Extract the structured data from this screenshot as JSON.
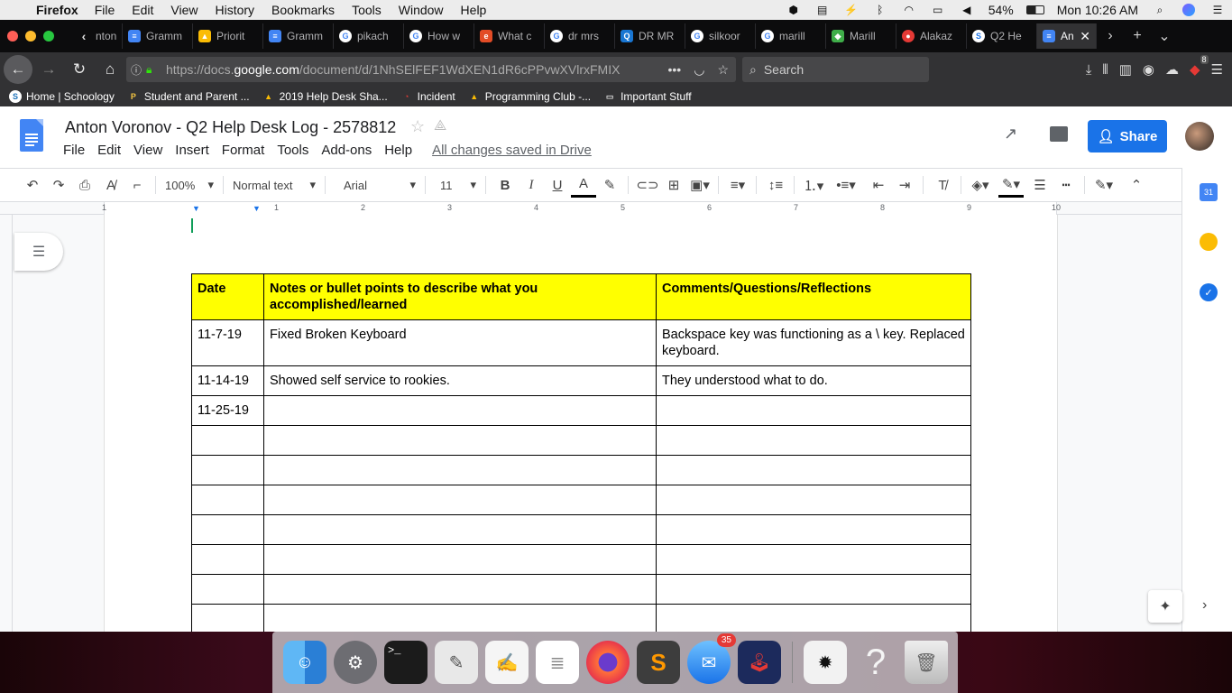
{
  "macos_menu": {
    "app_name": "Firefox",
    "items": [
      "File",
      "Edit",
      "View",
      "History",
      "Bookmarks",
      "Tools",
      "Window",
      "Help"
    ],
    "battery": "54%",
    "clock": "Mon 10:26 AM"
  },
  "browser": {
    "tabs": [
      {
        "label": "nton",
        "icon": "chevron-left"
      },
      {
        "label": "Gramm",
        "icon": "google-docs",
        "color": "#4285f4"
      },
      {
        "label": "Priorit",
        "icon": "google-drive",
        "color": "#fbbc04"
      },
      {
        "label": "Gramm",
        "icon": "google-docs",
        "color": "#4285f4"
      },
      {
        "label": "pikach",
        "icon": "google",
        "color": "#ffffff"
      },
      {
        "label": "How w",
        "icon": "google",
        "color": "#ffffff"
      },
      {
        "label": "What c",
        "icon": "e-site",
        "color": "#e34c26"
      },
      {
        "label": "dr mrs",
        "icon": "google",
        "color": "#ffffff"
      },
      {
        "label": "DR MR",
        "icon": "q-site",
        "color": "#1976d2"
      },
      {
        "label": "silkoor",
        "icon": "google",
        "color": "#ffffff"
      },
      {
        "label": "marill",
        "icon": "google",
        "color": "#ffffff"
      },
      {
        "label": "Marill",
        "icon": "pokemon",
        "color": "#3fae49"
      },
      {
        "label": "Alakaz",
        "icon": "pokeball",
        "color": "#e53935"
      },
      {
        "label": "Q2 He",
        "icon": "s-site",
        "color": "#ffffff"
      },
      {
        "label": "An",
        "icon": "google-docs",
        "color": "#4285f4",
        "active": true
      }
    ],
    "url_prefix": "https://docs.",
    "url_domain": "google.com",
    "url_path": "/document/d/1NhSElFEF1WdXEN1dR6cPPvwXVlrxFMIX",
    "search_placeholder": "Search",
    "notification_count": "8"
  },
  "bookmarks": [
    {
      "label": "Home | Schoology",
      "icon": "schoology"
    },
    {
      "label": "Student and Parent ...",
      "icon": "p-logo"
    },
    {
      "label": "2019 Help Desk Sha...",
      "icon": "google-drive"
    },
    {
      "label": "Incident",
      "icon": "servicenow"
    },
    {
      "label": "Programming Club -...",
      "icon": "google-drive"
    },
    {
      "label": "Important Stuff",
      "icon": "folder"
    }
  ],
  "doc": {
    "title": "Anton Voronov - Q2 Help Desk Log - 2578812",
    "menu": [
      "File",
      "Edit",
      "View",
      "Insert",
      "Format",
      "Tools",
      "Add-ons",
      "Help"
    ],
    "save_status": "All changes saved in Drive",
    "share_label": "Share"
  },
  "toolbar": {
    "zoom": "100%",
    "style": "Normal text",
    "font": "Arial",
    "size": "11"
  },
  "ruler": {
    "numbers": [
      "1",
      "1",
      "2",
      "3",
      "4",
      "5",
      "6",
      "7",
      "8",
      "9",
      "10"
    ]
  },
  "table": {
    "headers": [
      "Date",
      "Notes or bullet points to describe what you accomplished/learned",
      "Comments/Questions/Reflections"
    ],
    "rows": [
      [
        "11-7-19",
        "Fixed Broken Keyboard",
        "Backspace key was functioning as a \\ key. Replaced keyboard."
      ],
      [
        "11-14-19",
        "Showed self service to rookies.",
        "They understood what to do."
      ],
      [
        "11-25-19",
        "",
        ""
      ],
      [
        "",
        "",
        ""
      ],
      [
        "",
        "",
        ""
      ],
      [
        "",
        "",
        ""
      ],
      [
        "",
        "",
        ""
      ],
      [
        "",
        "",
        ""
      ],
      [
        "",
        "",
        ""
      ],
      [
        "",
        "",
        ""
      ]
    ]
  },
  "dock": {
    "mail_badge": "35",
    "apps": [
      "finder",
      "system-preferences",
      "terminal",
      "script-editor",
      "textedit",
      "notes",
      "firefox",
      "sublime-text",
      "mail",
      "joystick",
      "preview",
      "help",
      "trash"
    ]
  }
}
